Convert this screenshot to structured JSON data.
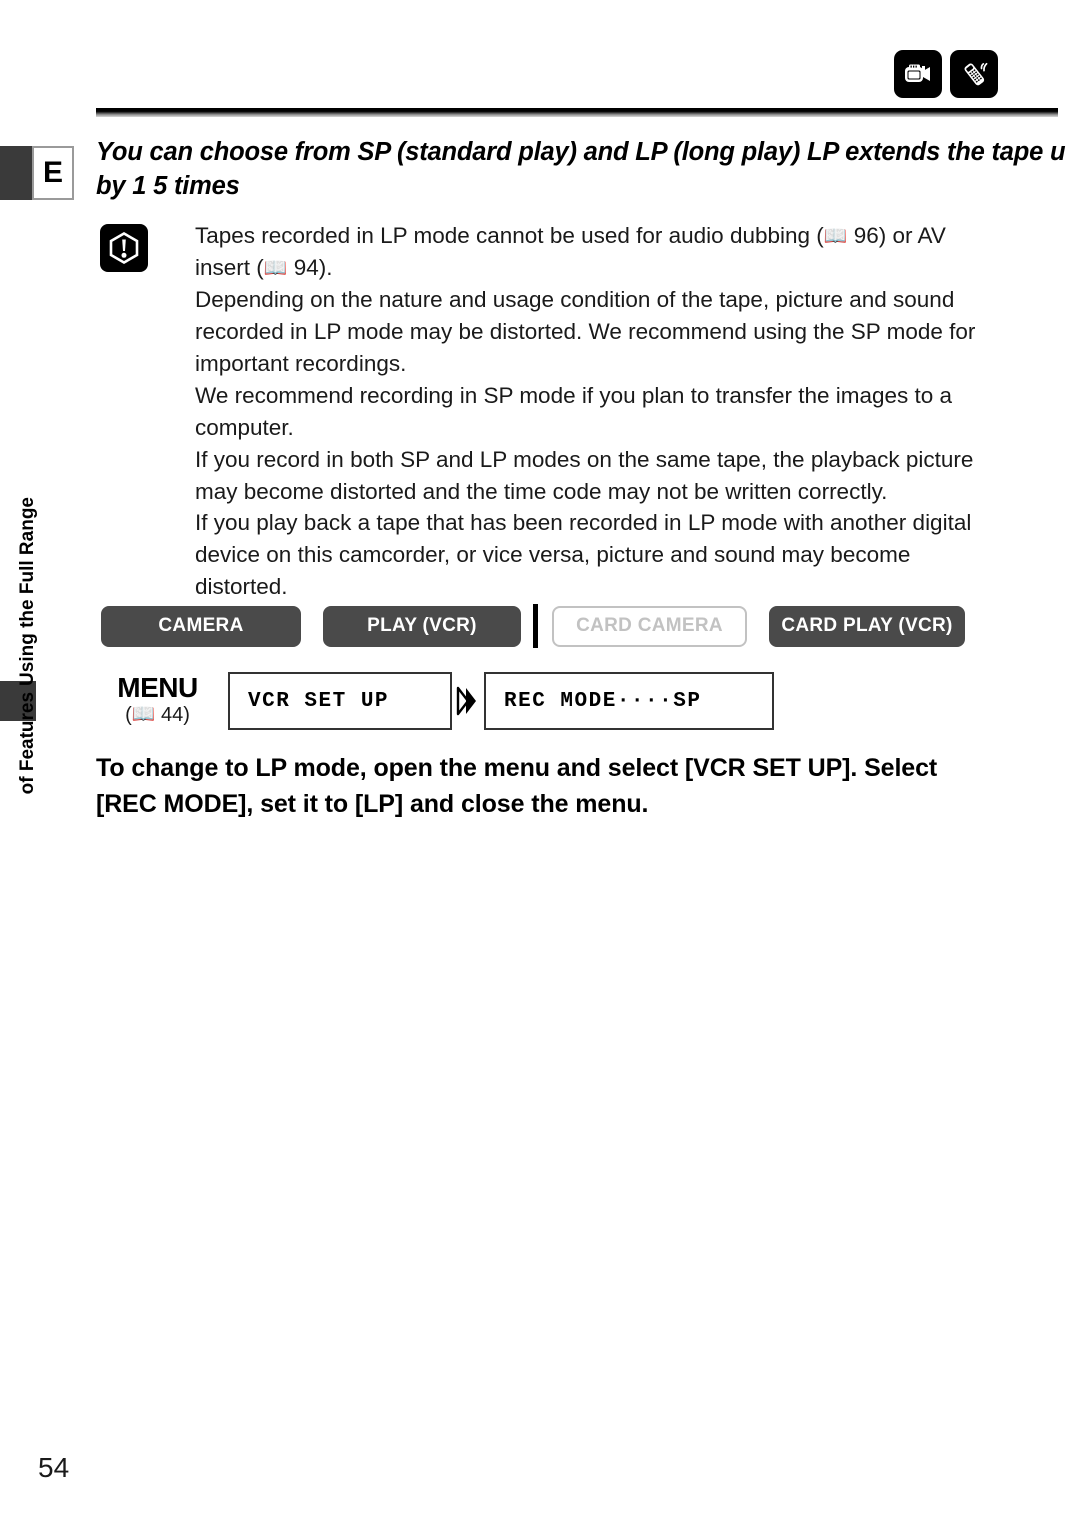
{
  "page": {
    "number": "54",
    "edition_marker": "E",
    "section_label_line1": "Using the Full Range",
    "section_label_line2": "of Features"
  },
  "header": {
    "icons": [
      {
        "name": "camcorder-icon",
        "label": "camcorder"
      },
      {
        "name": "remote-control-icon",
        "label": "remote control"
      }
    ]
  },
  "heading": {
    "line1": "You can choose from SP (standard play) and LP (long play)  LP extends the tape u",
    "line2": "by 1 5 times"
  },
  "caution": {
    "icon_name": "caution-exclamation-icon",
    "paragraphs": [
      {
        "pre": "Tapes recorded in LP mode cannot be used for audio dubbing (",
        "ref1": "96",
        "mid": ") or AV insert (",
        "ref2": "94",
        "post": ")."
      },
      {
        "text": "Depending on the nature and usage condition of the tape, picture and sound recorded in LP mode may be distorted. We recommend using the SP mode for important recordings."
      },
      {
        "text": "We recommend recording in SP mode if you plan to transfer the images to a computer."
      },
      {
        "text": "If you record in both SP and LP modes on the same tape, the playback picture may become distorted and the time code may not be written correctly."
      },
      {
        "text": "If you play back a tape that has been recorded in LP mode with another digital device on this camcorder, or vice versa, picture and sound may become distorted."
      }
    ]
  },
  "modes": [
    {
      "label": "CAMERA",
      "enabled": true
    },
    {
      "label": "PLAY (VCR)",
      "enabled": true
    },
    {
      "label": "CARD CAMERA",
      "enabled": false
    },
    {
      "label": "CARD PLAY (VCR)",
      "enabled": true
    }
  ],
  "menu": {
    "title": "MENU",
    "ref_page": "44",
    "ref_open": "(",
    "ref_close": ")",
    "item1": "VCR SET UP",
    "item2": "REC MODE····SP",
    "arrow_name": "double-chevron-right-icon"
  },
  "instruction": {
    "line1": "To change to LP mode, open the menu and select [VCR SET UP]. Select",
    "line2": "[REC MODE], set it to [LP] and close the menu."
  },
  "colors": {
    "dark_tab": "#3a3a3a",
    "button_on": "#4a4a4a",
    "button_off_border": "#c2c2c2",
    "text": "#000000"
  }
}
